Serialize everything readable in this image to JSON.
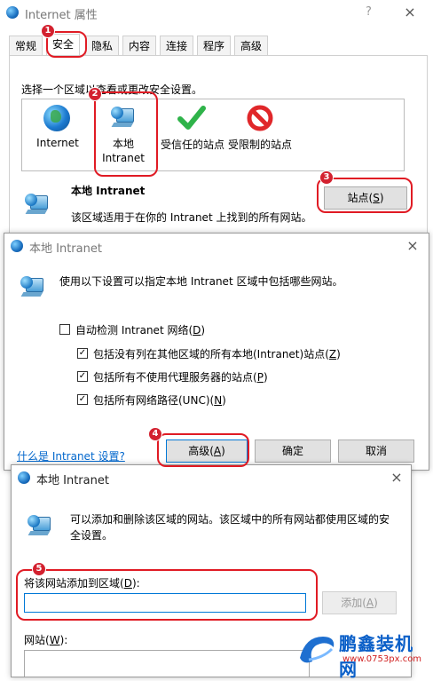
{
  "win1": {
    "title": "Internet 属性",
    "help": "?",
    "close": "×",
    "tabs": [
      "常规",
      "安全",
      "隐私",
      "内容",
      "连接",
      "程序",
      "高级"
    ],
    "instruction": "选择一个区域以查看或更改安全设置。",
    "zones": [
      {
        "label": "Internet",
        "icon": "globe-icon"
      },
      {
        "label": "本地\nIntranet",
        "icon": "intranet-icon"
      },
      {
        "label": "受信任的站点",
        "icon": "check-icon"
      },
      {
        "label": "受限制的站点",
        "icon": "restricted-icon"
      }
    ],
    "zone_title": "本地 Intranet",
    "zone_desc": "该区域适用于在你的 Intranet 上找到的所有网站。",
    "sites_button": "站点(",
    "sites_key": "S",
    "sites_end": ")"
  },
  "win2": {
    "title": "本地 Intranet",
    "close": "×",
    "desc": "使用以下设置可以指定本地 Intranet 区域中包括哪些网站。",
    "auto_detect": {
      "pre": "自动检测 Intranet 网络(",
      "key": "D",
      "post": ")",
      "checked": false
    },
    "opt1": {
      "pre": "包括没有列在其他区域的所有本地(Intranet)站点(",
      "key": "Z",
      "post": ")",
      "checked": true
    },
    "opt2": {
      "pre": "包括所有不使用代理服务器的站点(",
      "key": "P",
      "post": ")",
      "checked": true
    },
    "opt3": {
      "pre": "包括所有网络路径(UNC)(",
      "key": "N",
      "post": ")",
      "checked": true
    },
    "link": "什么是 Intranet 设置?",
    "advanced": {
      "pre": "高级(",
      "key": "A",
      "post": ")"
    },
    "ok": "确定",
    "cancel": "取消"
  },
  "win3": {
    "title": "本地 Intranet",
    "close": "×",
    "desc_line1": "可以添加和删除该区域的网站。该区域中的所有网站都使用区域的安",
    "desc_line2": "全设置。",
    "add_label": {
      "pre": "将该网站添加到区域(",
      "key": "D",
      "post": "):"
    },
    "add_value": "",
    "add_button": {
      "pre": "添加(",
      "key": "A",
      "post": ")"
    },
    "sites_label": {
      "pre": "网站(",
      "key": "W",
      "post": "):"
    }
  },
  "steps": [
    "1",
    "2",
    "3",
    "4",
    "5"
  ],
  "watermark": {
    "brand": "鹏鑫装机网",
    "url": "www.0753px.com"
  },
  "colors": {
    "annotation_red": "#e01b24",
    "link_blue": "#0066cc",
    "focus_blue": "#0078d7"
  }
}
